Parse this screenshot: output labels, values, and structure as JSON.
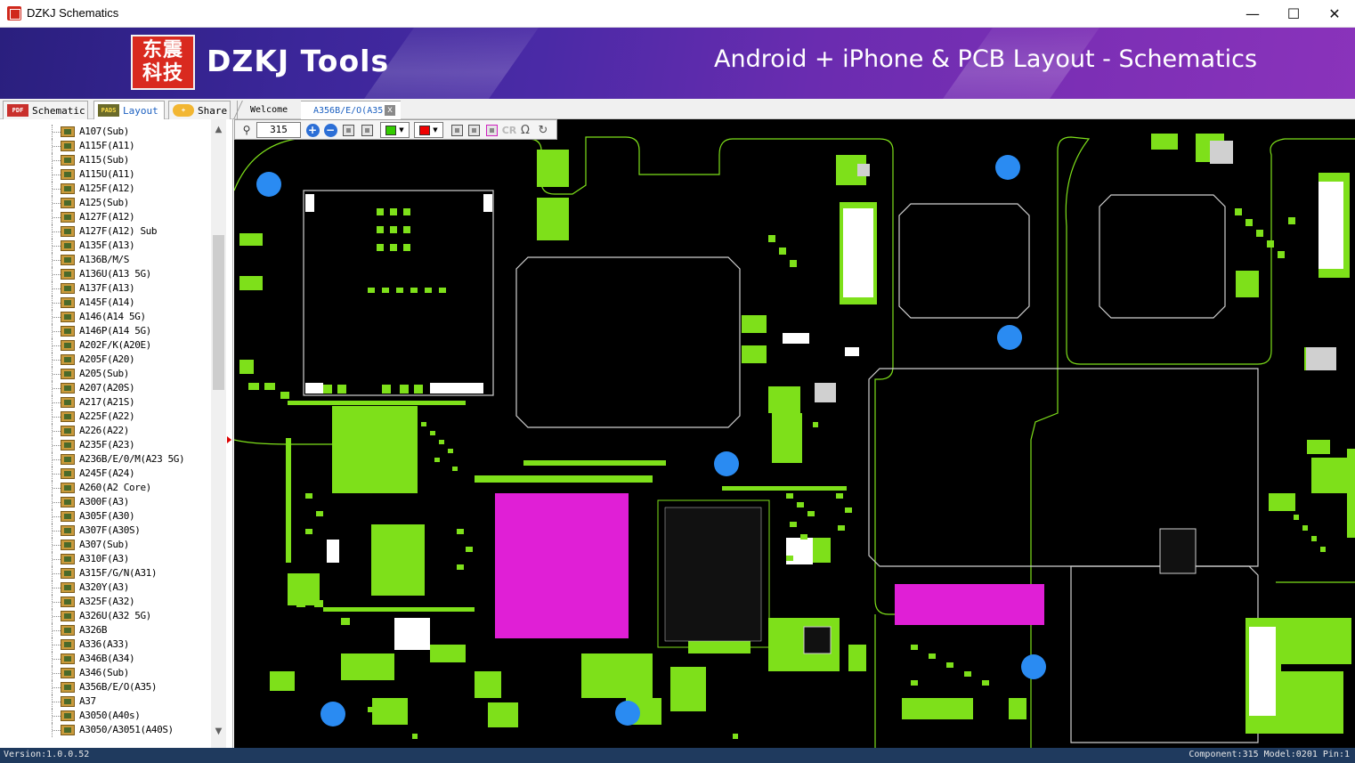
{
  "window": {
    "title": "DZKJ Schematics",
    "minimize": "—",
    "maximize": "☐",
    "close": "✕"
  },
  "banner": {
    "logo_line1": "东震",
    "logo_line2": "科技",
    "brand": "DZKJ Tools",
    "tagline": "Android + iPhone & PCB Layout - Schematics"
  },
  "mode_tabs": [
    {
      "icon_text": "PDF",
      "label": "Schematic",
      "icon": "pdf-icon"
    },
    {
      "icon_text": "PADS",
      "label": "Layout",
      "icon": "pads-icon"
    },
    {
      "icon_text": "+",
      "label": "Share",
      "icon": "cloud-share-icon"
    }
  ],
  "doc_tabs": [
    {
      "label": "Welcome"
    },
    {
      "label": "A356B/E/O(A35)",
      "close": "x"
    }
  ],
  "toolbar": {
    "zoom_value": "315",
    "zoom_in": "+",
    "zoom_out": "−",
    "cr_label": "CR",
    "omega": "Ω",
    "clock": "↻",
    "color1": "#33cc00",
    "color2": "#ee0000"
  },
  "tree": {
    "items": [
      "A107(Sub)",
      "A115F(A11)",
      "A115(Sub)",
      "A115U(A11)",
      "A125F(A12)",
      "A125(Sub)",
      "A127F(A12)",
      "A127F(A12) Sub",
      "A135F(A13)",
      "A136B/M/S",
      "A136U(A13 5G)",
      "A137F(A13)",
      "A145F(A14)",
      "A146(A14 5G)",
      "A146P(A14 5G)",
      "A202F/K(A20E)",
      "A205F(A20)",
      "A205(Sub)",
      "A207(A20S)",
      "A217(A21S)",
      "A225F(A22)",
      "A226(A22)",
      "A235F(A23)",
      "A236B/E/0/M(A23 5G)",
      "A245F(A24)",
      "A260(A2 Core)",
      "A300F(A3)",
      "A305F(A30)",
      "A307F(A30S)",
      "A307(Sub)",
      "A310F(A3)",
      "A315F/G/N(A31)",
      "A320Y(A3)",
      "A325F(A32)",
      "A326U(A32 5G)",
      "A326B",
      "A336(A33)",
      "A346B(A34)",
      "A346(Sub)",
      "A356B/E/O(A35)",
      "A37",
      "A3050(A40s)",
      "A3050/A3051(A40S)"
    ],
    "scroll_up": "▲",
    "scroll_down": "▼"
  },
  "status": {
    "version": "Version:1.0.0.52",
    "component": "Component:315 Model:0201 Pin:1"
  },
  "colors": {
    "trace": "#7ee01a",
    "highlight": "#e01fd6",
    "via": "#2a8bf2",
    "pad": "#d0d0d0"
  }
}
